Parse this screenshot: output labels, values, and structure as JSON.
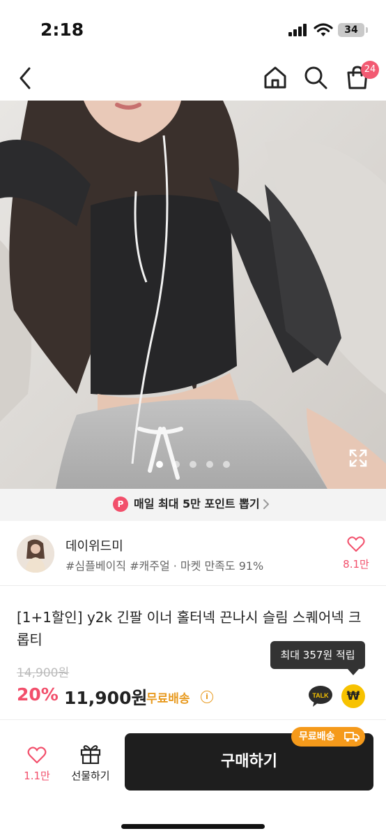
{
  "status_bar": {
    "time": "2:18",
    "battery": "34"
  },
  "nav": {
    "cart_count": "24",
    "icons": [
      "back-icon",
      "home-icon",
      "search-icon",
      "cart-icon"
    ]
  },
  "gallery": {
    "page_count": 5,
    "active_index": 1
  },
  "point_banner": {
    "badge": "P",
    "text": "매일 최대 5만 포인트 뽑기"
  },
  "seller": {
    "name": "데이위드미",
    "tags": "#심플베이직 #캐주얼 · 마켓 만족도 91%",
    "likes": "8.1만"
  },
  "product": {
    "title": "[1+1할인] y2k 긴팔 이너 홀터넥 끈나시 슬림 스퀘어넥 크롭티",
    "original_price": "14,900원",
    "discount": "20%",
    "price": "11,900원",
    "shipping": "무료배송",
    "tooltip": "최대 357원 적립",
    "talk_label": "TALK",
    "won_symbol": "₩"
  },
  "bottom_bar": {
    "like_count": "1.1만",
    "gift_label": "선물하기",
    "buy_label": "구매하기",
    "buy_badge": "무료배송"
  },
  "colors": {
    "accent_pink": "#f24f6b",
    "shipping_orange": "#e89a1f",
    "buy_button": "#1e1e1e",
    "badge_orange": "#f59a1b",
    "kakao_yellow": "#f7c200"
  }
}
